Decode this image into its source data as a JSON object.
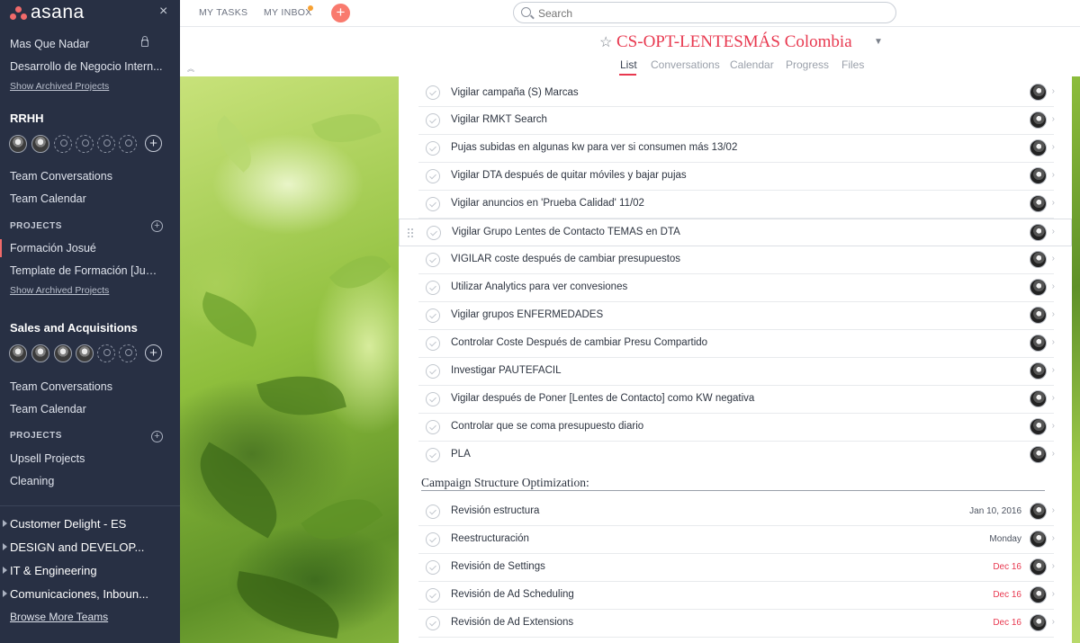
{
  "sidebar": {
    "logo_text": "asana",
    "close": "×",
    "favorites": [
      "Mas Que Nadar",
      "Desarrollo de Negocio Intern..."
    ],
    "show_archived_1": "Show Archived Projects",
    "team1": {
      "name": "RRHH",
      "conversations": "Team Conversations",
      "calendar": "Team Calendar",
      "projects_label": "PROJECTS",
      "projects": [
        "Formación Josué",
        "Template de Formación [Juni..."
      ],
      "show_archived": "Show Archived Projects"
    },
    "team2": {
      "name": "Sales and Acquisitions",
      "conversations": "Team Conversations",
      "calendar": "Team Calendar",
      "projects_label": "PROJECTS",
      "projects": [
        "Upsell Projects",
        "Cleaning"
      ]
    },
    "collapsed_teams": [
      "Customer Delight - ES",
      "DESIGN and DEVELOP...",
      "IT & Engineering",
      "Comunicaciones, Inboun..."
    ],
    "browse_more": "Browse More Teams"
  },
  "topbar": {
    "my_tasks": "MY TASKS",
    "my_inbox": "MY INBOX",
    "add": "+",
    "search_placeholder": "Search"
  },
  "project": {
    "title": "CS-OPT-LENTESMÁS Colombia",
    "tabs": [
      "List",
      "Conversations",
      "Calendar",
      "Progress",
      "Files"
    ],
    "active_tab": "List"
  },
  "tasks": [
    {
      "name": "Vigilar campaña (S) Marcas",
      "due": ""
    },
    {
      "name": "Vigilar RMKT Search",
      "due": ""
    },
    {
      "name": "Pujas subidas en algunas kw para ver si consumen más 13/02",
      "due": ""
    },
    {
      "name": "Vigilar DTA después de quitar móviles y bajar pujas",
      "due": ""
    },
    {
      "name": "Vigilar anuncios en 'Prueba Calidad' 11/02",
      "due": ""
    },
    {
      "name": "Vigilar Grupo Lentes de Contacto TEMAS en DTA",
      "due": ""
    },
    {
      "name": "VIGILAR coste después de cambiar presupuestos",
      "due": ""
    },
    {
      "name": "Utilizar Analytics para ver convesiones",
      "due": ""
    },
    {
      "name": "Vigilar grupos ENFERMEDADES",
      "due": ""
    },
    {
      "name": "Controlar Coste Después de cambiar Presu Compartido",
      "due": ""
    },
    {
      "name": "Investigar PAUTEFACIL",
      "due": ""
    },
    {
      "name": "Vigilar después de Poner [Lentes de Contacto] como KW negativa",
      "due": ""
    },
    {
      "name": "Controlar que se coma presupuesto diario",
      "due": ""
    },
    {
      "name": "PLA",
      "due": ""
    }
  ],
  "section": {
    "title": "Campaign Structure Optimization:",
    "tasks": [
      {
        "name": "Revisión estructura",
        "due": "Jan 10, 2016",
        "overdue": false
      },
      {
        "name": "Reestructuración",
        "due": "Monday",
        "overdue": false
      },
      {
        "name": "Revisión de Settings",
        "due": "Dec 16",
        "overdue": true
      },
      {
        "name": "Revisión de Ad Scheduling",
        "due": "Dec 16",
        "overdue": true
      },
      {
        "name": "Revisión de Ad Extensions",
        "due": "Dec 16",
        "overdue": true
      }
    ]
  },
  "colors": {
    "accent": "#e8384f",
    "sidebar": "#283044"
  }
}
